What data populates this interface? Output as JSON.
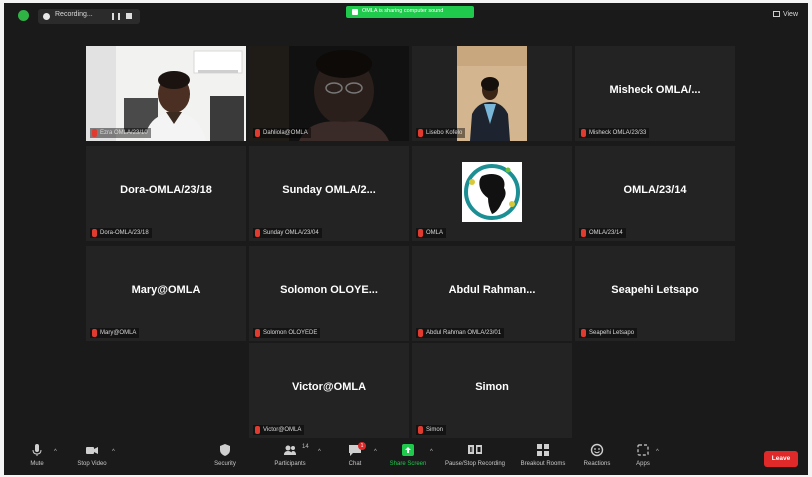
{
  "topbar": {
    "recording_label": "Recording...",
    "share_banner": "OMLA is sharing computer sound",
    "view_label": "View"
  },
  "tiles": [
    {
      "big": "",
      "name": "Ezra OMLA/23/10",
      "type": "video"
    },
    {
      "big": "",
      "name": "Dahliola@OMLA",
      "type": "video",
      "active": true
    },
    {
      "big": "",
      "name": "Lisebo Kofelo",
      "type": "video"
    },
    {
      "big": "Misheck OMLA/...",
      "name": "Misheck OMLA/23/33",
      "type": "text"
    },
    {
      "big": "Dora-OMLA/23/18",
      "name": "Dora-OMLA/23/18",
      "type": "text"
    },
    {
      "big": "Sunday OMLA/2...",
      "name": "Sunday OMLA/23/04",
      "type": "text"
    },
    {
      "big": "",
      "name": "OMLA",
      "type": "logo"
    },
    {
      "big": "OMLA/23/14",
      "name": "OMLA/23/14",
      "type": "text"
    },
    {
      "big": "Mary@OMLA",
      "name": "Mary@OMLA",
      "type": "text"
    },
    {
      "big": "Solomon OLOYE...",
      "name": "Solomon OLOYEDE",
      "type": "text"
    },
    {
      "big": "Abdul Rahman...",
      "name": "Abdul Rahman OMLA/23/01",
      "type": "text"
    },
    {
      "big": "Seapehi Letsapo",
      "name": "Seapehi Letsapo",
      "type": "text"
    },
    {
      "big": "Victor@OMLA",
      "name": "Victor@OMLA",
      "type": "text"
    },
    {
      "big": "Simon",
      "name": "Simon",
      "type": "text"
    }
  ],
  "toolbar": {
    "mute": "Mute",
    "stop_video": "Stop Video",
    "security": "Security",
    "participants": "Participants",
    "participants_count": "14",
    "chat": "Chat",
    "chat_badge": "1",
    "share_screen": "Share Screen",
    "pause_recording": "Pause/Stop Recording",
    "breakout": "Breakout Rooms",
    "reactions": "Reactions",
    "apps": "Apps",
    "leave": "Leave"
  },
  "colors": {
    "accent_green": "#1ec94c",
    "active_speaker": "#c4d93b",
    "leave_red": "#e02a2a",
    "muted_red": "#e03b2e"
  }
}
